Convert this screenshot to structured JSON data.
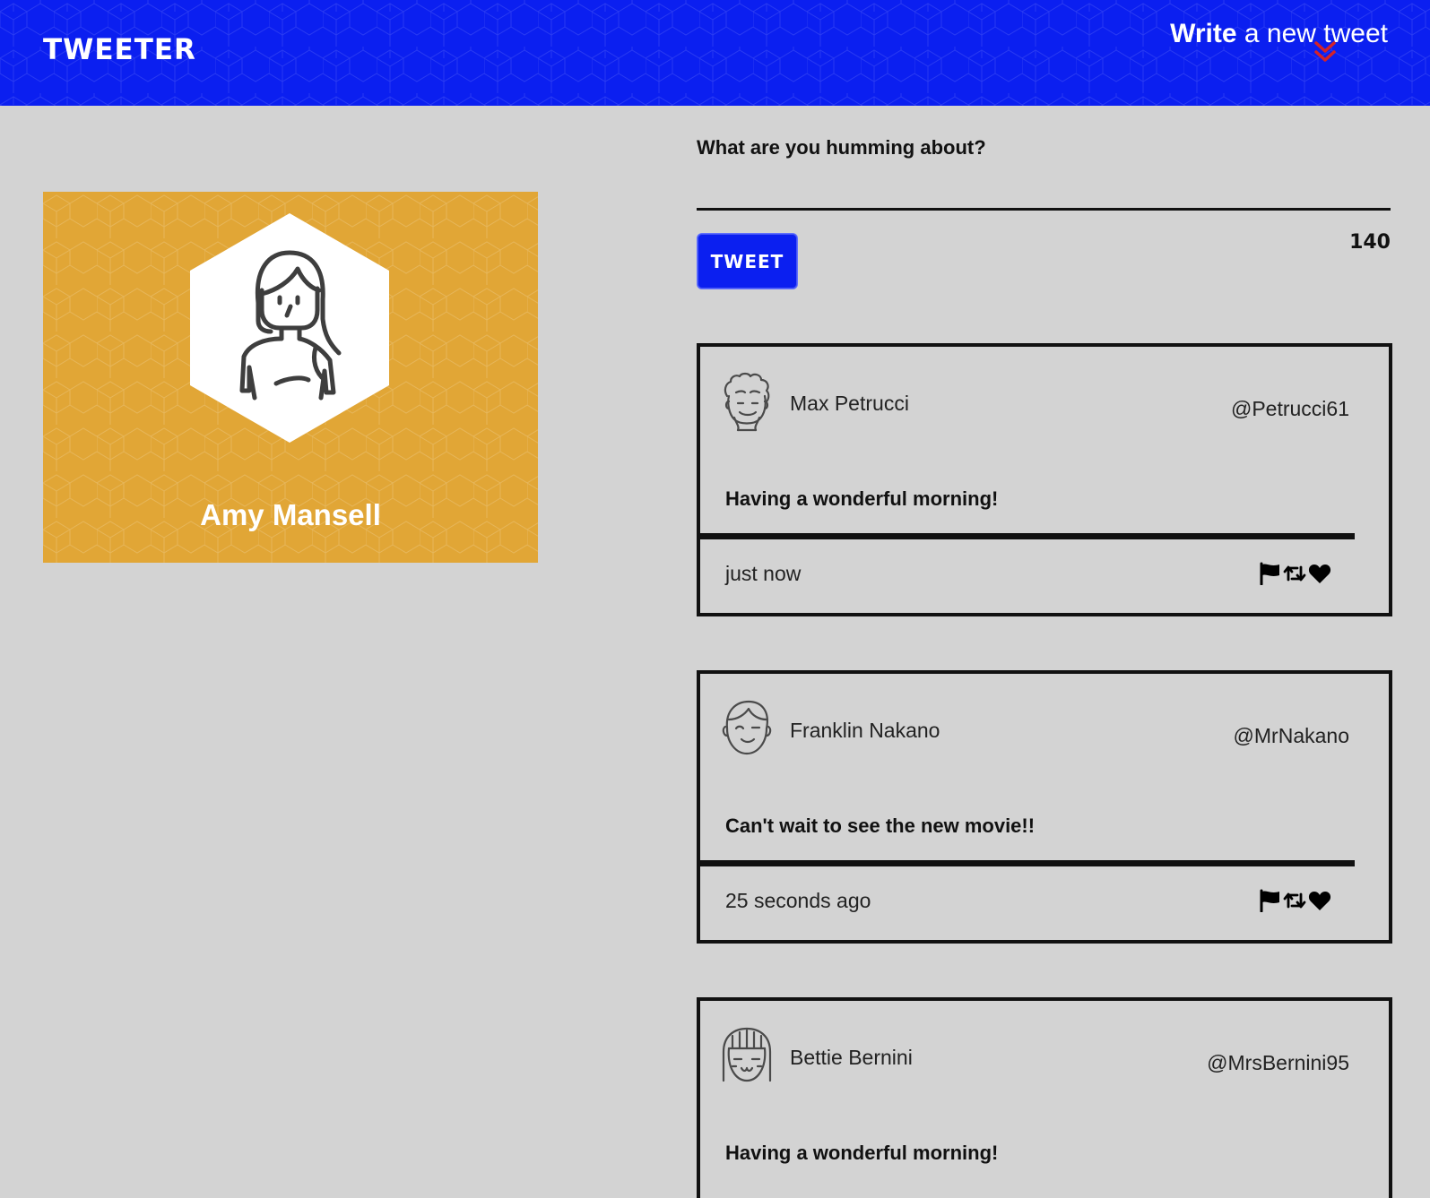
{
  "nav": {
    "brand": "TWEETER",
    "write_bold": "Write",
    "write_rest": " a new tweet",
    "chevron_icon": "double-chevron-down-icon",
    "background_color": "#0b1ff0",
    "chevron_color": "#d3232a"
  },
  "profile": {
    "name": "Amy Mansell",
    "avatar_icon": "woman-avatar-icon",
    "card_color": "#e1a636"
  },
  "compose": {
    "label": "What are you humming about?",
    "placeholder": "",
    "button_label": "Tweet",
    "counter": "140"
  },
  "tweets": [
    {
      "author": "Max Petrucci",
      "handle": "@Petrucci61",
      "text": "Having a wonderful morning!",
      "time": "just now",
      "avatar_icon": "curly-hair-man-avatar-icon"
    },
    {
      "author": "Franklin Nakano",
      "handle": "@MrNakano",
      "text": "Can't wait to see the new movie!!",
      "time": "25 seconds ago",
      "avatar_icon": "winking-man-avatar-icon"
    },
    {
      "author": "Bettie Bernini",
      "handle": "@MrsBernini95",
      "text": "Having a wonderful morning!",
      "time": "",
      "avatar_icon": "bangs-woman-avatar-icon"
    }
  ],
  "actions": [
    "flag-icon",
    "retweet-icon",
    "heart-icon"
  ]
}
